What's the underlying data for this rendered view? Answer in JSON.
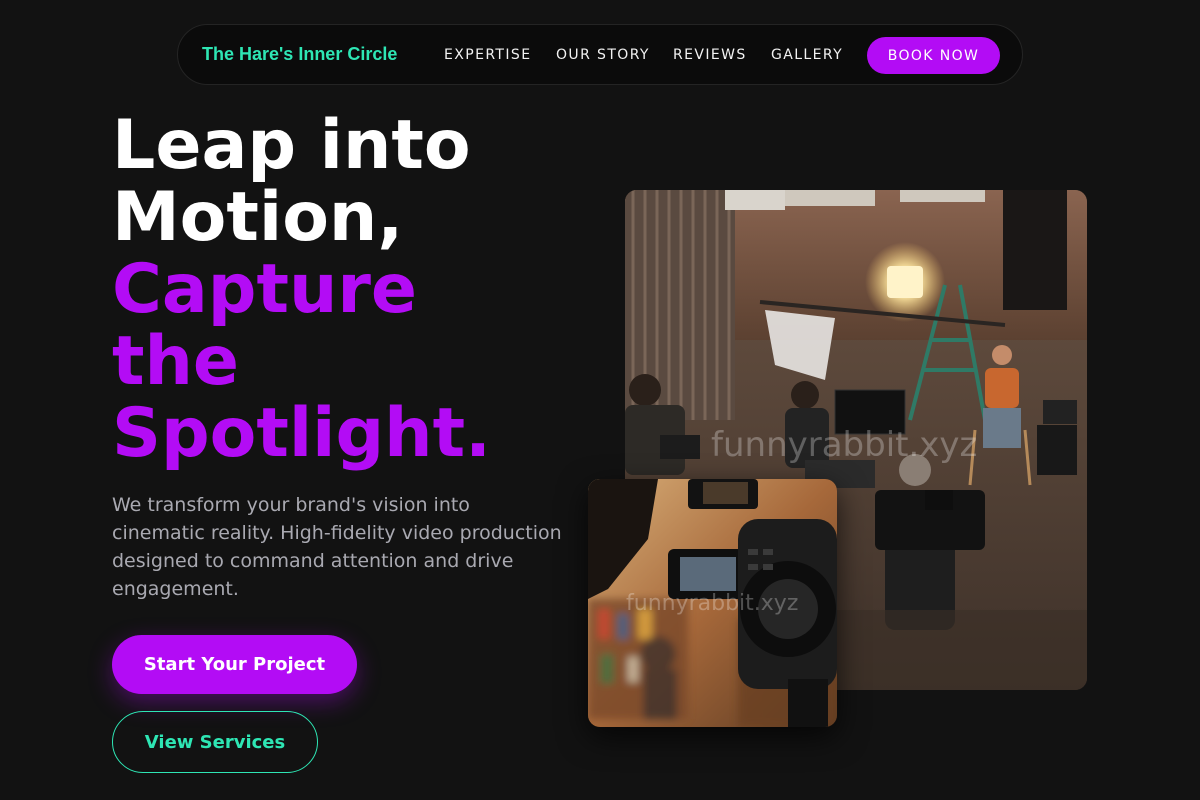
{
  "brand": {
    "name": "The Hare's Inner Circle",
    "color": "#2ee6b4"
  },
  "nav": {
    "links": [
      "EXPERTISE",
      "OUR STORY",
      "REVIEWS",
      "GALLERY"
    ],
    "cta": "BOOK NOW"
  },
  "hero": {
    "headline_white": [
      "Leap into",
      "Motion,"
    ],
    "headline_purple": [
      "Capture",
      "the",
      "Spotlight."
    ],
    "lead": "We transform your brand's vision into cinematic reality. High-fidelity video production designed to command attention and drive engagement.",
    "primary_cta": "Start Your Project",
    "secondary_cta": "View Services"
  },
  "images": {
    "main_alt": "Film crew shooting an interview in a brick warehouse studio",
    "small_alt": "Close-up of a cinema camera monitor in a library",
    "watermark": "funnyrabbit.xyz",
    "watermark_small": "funnyrabbit.xyz"
  },
  "colors": {
    "accent_purple": "#b30cf5",
    "accent_teal": "#2ee6b4",
    "background": "#121212",
    "lead_text": "#a9a9b1"
  }
}
